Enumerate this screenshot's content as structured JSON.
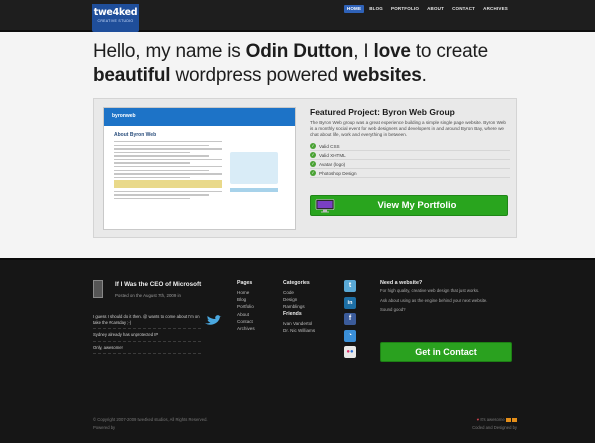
{
  "header": {
    "logo_line1": "twe4ked",
    "logo_line2": "CREATIVE STUDIO",
    "nav": [
      {
        "label": "HOME",
        "active": true
      },
      {
        "label": "BLOG",
        "active": false
      },
      {
        "label": "PORTFOLIO",
        "active": false
      },
      {
        "label": "ABOUT",
        "active": false
      },
      {
        "label": "CONTACT",
        "active": false
      },
      {
        "label": "ARCHIVES",
        "active": false
      }
    ]
  },
  "hero": {
    "part1": "Hello, my name is ",
    "name": "Odin Dutton",
    "part2": ", I ",
    "love": "love",
    "part3": " to create",
    "beautiful": "beautiful",
    "part4": " wordpress powered ",
    "websites": "websites",
    "part5": "."
  },
  "featured": {
    "title": "Featured Project: Byron Web Group",
    "description": "The Byron Web group was a great experience building a simple single page website. Byron Web is a monthly social event for web designers and developers in and around Byron Bay, where we chat about life, work and everything in between.",
    "checks": [
      "Valid CSS",
      "Valid XHTML",
      "Avatar (logo)",
      "Photoshop Design"
    ],
    "button_label": "View My Portfolio",
    "screenshot": {
      "logo": "byronweb",
      "title": "About Byron Web"
    }
  },
  "footer": {
    "post": {
      "title": "If I Was the CEO of Microsoft",
      "date": "Posted on the August 7th, 2009 in"
    },
    "tweets": [
      {
        "text": "I guess I should do it then. @ wants to come about I'm on take the #carsday ;-)",
        "meta": ""
      },
      {
        "text": "Sydney already has unprotected IP",
        "meta": ""
      },
      {
        "text": "Only, awesome!",
        "meta": ""
      }
    ],
    "pages": {
      "heading": "Pages",
      "items": [
        "Home",
        "Blog",
        "Portfolio",
        "About",
        "Contact",
        "Archives"
      ]
    },
    "categories": {
      "heading": "Categories",
      "items": [
        "Code",
        "Design",
        "Ramblings"
      ],
      "friends_heading": "Friends",
      "friends": [
        "Ivan Vandertol",
        "Dr. Nic Williams"
      ]
    },
    "socials": [
      {
        "name": "twitter-icon",
        "glyph": "t"
      },
      {
        "name": "linkedin-icon",
        "glyph": "in"
      },
      {
        "name": "facebook-icon",
        "glyph": "f"
      },
      {
        "name": "rss-icon",
        "glyph": "◔"
      },
      {
        "name": "flickr-icon",
        "glyph": "●"
      }
    ],
    "need": {
      "heading": "Need a website?",
      "p1": "For high quality, creative web design that just works.",
      "p2": "Ask about using as the engine behind your next website.",
      "p3": "Sound good?",
      "button_label": "Get in Contact"
    },
    "copyright": "© Copyright 2007-2009 twe4ked studios, All Rights Reserved.",
    "powered": "Powered by",
    "credits_line1": "It's awesome",
    "credits_line2": "Coded and Designed by"
  }
}
